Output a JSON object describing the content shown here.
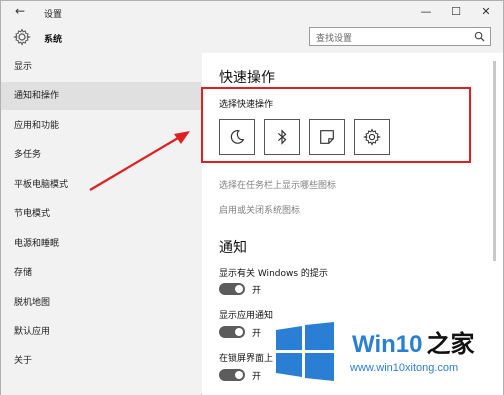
{
  "titlebar": {
    "back_glyph": "←",
    "title": "设置",
    "minimize": "—",
    "maximize": "☐",
    "close": "✕"
  },
  "header": {
    "section": "系统",
    "search_placeholder": "查找设置"
  },
  "sidebar": {
    "items": [
      {
        "label": "显示"
      },
      {
        "label": "通知和操作",
        "active": true
      },
      {
        "label": "应用和功能"
      },
      {
        "label": "多任务"
      },
      {
        "label": "平板电脑模式"
      },
      {
        "label": "节电模式"
      },
      {
        "label": "电源和睡眠"
      },
      {
        "label": "存储"
      },
      {
        "label": "脱机地图"
      },
      {
        "label": "默认应用"
      },
      {
        "label": "关于"
      }
    ]
  },
  "content": {
    "quick_actions_title": "快速操作",
    "quick_actions_subtitle": "选择快速操作",
    "quick_action_buttons": [
      {
        "icon": "moon-icon"
      },
      {
        "icon": "bluetooth-icon"
      },
      {
        "icon": "note-icon"
      },
      {
        "icon": "gear-icon"
      }
    ],
    "link_taskbar_icons": "选择在任务栏上显示哪些图标",
    "link_system_icons": "启用或关闭系统图标",
    "notifications_title": "通知",
    "options": [
      {
        "label": "显示有关 Windows 的提示",
        "toggle_state": "开"
      },
      {
        "label": "显示应用通知",
        "toggle_state": "开"
      },
      {
        "label": "在锁屏界面上",
        "toggle_state": "开"
      }
    ]
  },
  "watermark": {
    "brand_win10": "Win10",
    "brand_zhijia": "之家",
    "url": "www.win10xitong.com"
  },
  "colors": {
    "annotation_red": "#e02020",
    "watermark_blue": "#2a7fd4",
    "sidebar_bg": "#f2f2f2",
    "active_item_bg": "#e0e0e0"
  }
}
